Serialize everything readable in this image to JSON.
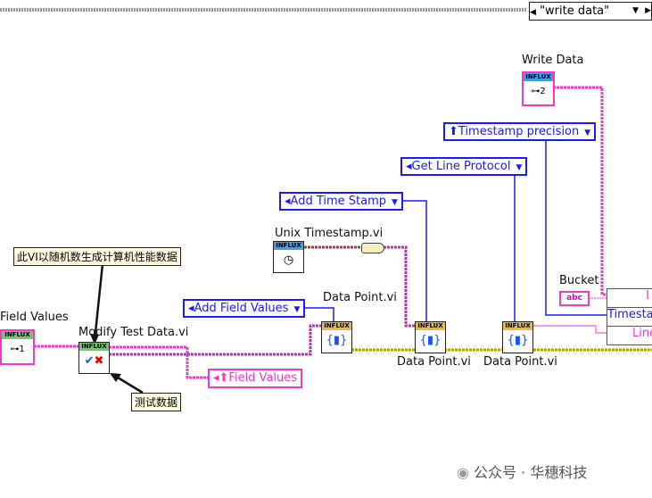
{
  "case_selector": {
    "value": "\"write data\""
  },
  "nodes": {
    "write_data": {
      "label": "Write Data",
      "badge": "INFLUX",
      "index": "2"
    },
    "unix_timestamp": {
      "label": "Unix Timestamp.vi",
      "badge": "INFLUX"
    },
    "data_point_1": {
      "label": "Data Point.vi",
      "badge": "INFLUX"
    },
    "data_point_2": {
      "label": "Data Point.vi",
      "badge": "INFLUX"
    },
    "data_point_3": {
      "label": "Data Point.vi",
      "badge": "INFLUX"
    },
    "field_values": {
      "label": "Field Values",
      "badge": "INFLUX",
      "index": "1"
    },
    "modify_test_data": {
      "label": "Modify Test Data.vi",
      "badge": "INFLUX"
    },
    "bucket": {
      "label": "Bucket",
      "value": "abc"
    }
  },
  "enums": {
    "timestamp_precision": "Timestamp precision",
    "get_line_protocol": "Get Line Protocol",
    "add_time_stamp": "Add Time Stamp",
    "add_field_values": "Add Field Values"
  },
  "indicator": {
    "field_values": "Field Values"
  },
  "bundle": {
    "rows": [
      "I",
      "Timesta",
      "Line"
    ]
  },
  "comments": {
    "vi_note": "此VI以随机数生成计算机性能数据",
    "test_data": "测试数据"
  },
  "watermark": "公众号 · 华穗科技",
  "colors": {
    "string_wire": "#ff33cc",
    "enum_wire": "#1a1aff",
    "cluster_wire": "#a040a0",
    "data_wire": "#b0a000",
    "timestamp_wire": "#c03030"
  }
}
